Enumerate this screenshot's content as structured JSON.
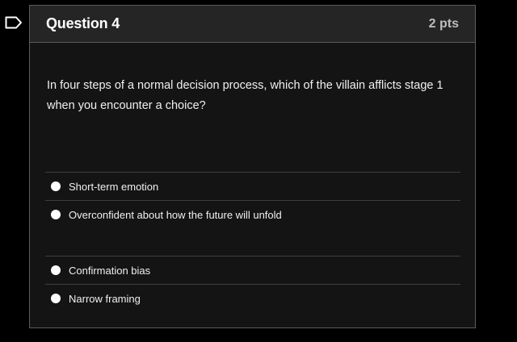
{
  "question": {
    "title": "Question 4",
    "points": "2 pts",
    "text": "In four steps of a normal decision process, which of the villain afflicts stage 1 when you encounter a choice?"
  },
  "answers": [
    {
      "label": "Short-term emotion"
    },
    {
      "label": "Overconfident about how the future will unfold"
    },
    {
      "label": "Confirmation bias"
    },
    {
      "label": "Narrow framing"
    }
  ],
  "icons": {
    "flag": "bookmark-flag-icon",
    "radio": "radio-circle-icon"
  },
  "colors": {
    "background": "#000000",
    "card": "#141414",
    "header": "#252525",
    "border": "#5c5c5c",
    "text": "#f0f0f0"
  }
}
